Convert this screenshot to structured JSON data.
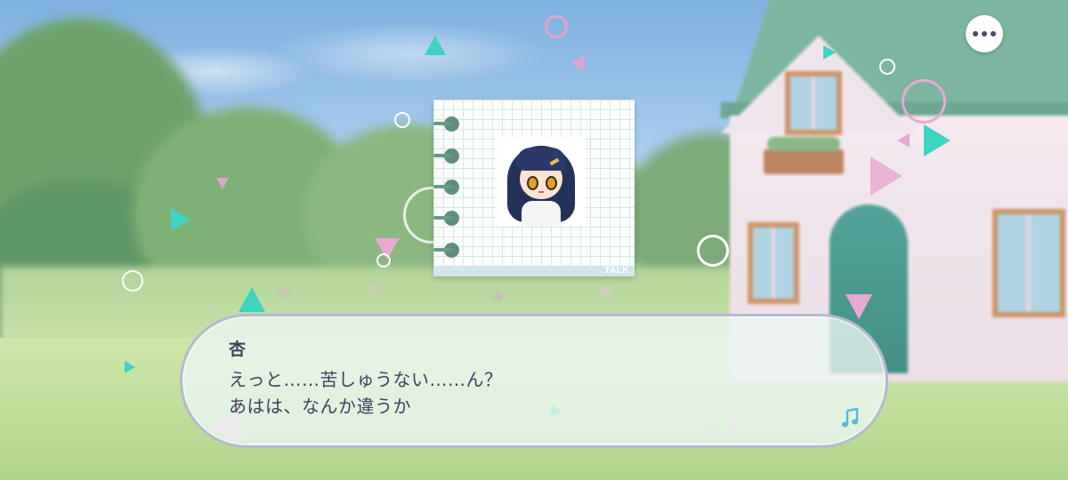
{
  "menu": {
    "icon": "more-dots-icon"
  },
  "talk_card": {
    "label": "TALK",
    "character_icon": "character-portrait"
  },
  "dialogue": {
    "speaker": "杏",
    "lines": [
      "えっと……苦しゅうない……ん？",
      "あはは、なんか違うか"
    ],
    "advance_icon": "music-note-icon"
  },
  "colors": {
    "text": "#3f3f5c",
    "dialog_border": "#acb0cc",
    "accent_teal": "#3fd3c0",
    "accent_pink": "#e7a9d3"
  }
}
